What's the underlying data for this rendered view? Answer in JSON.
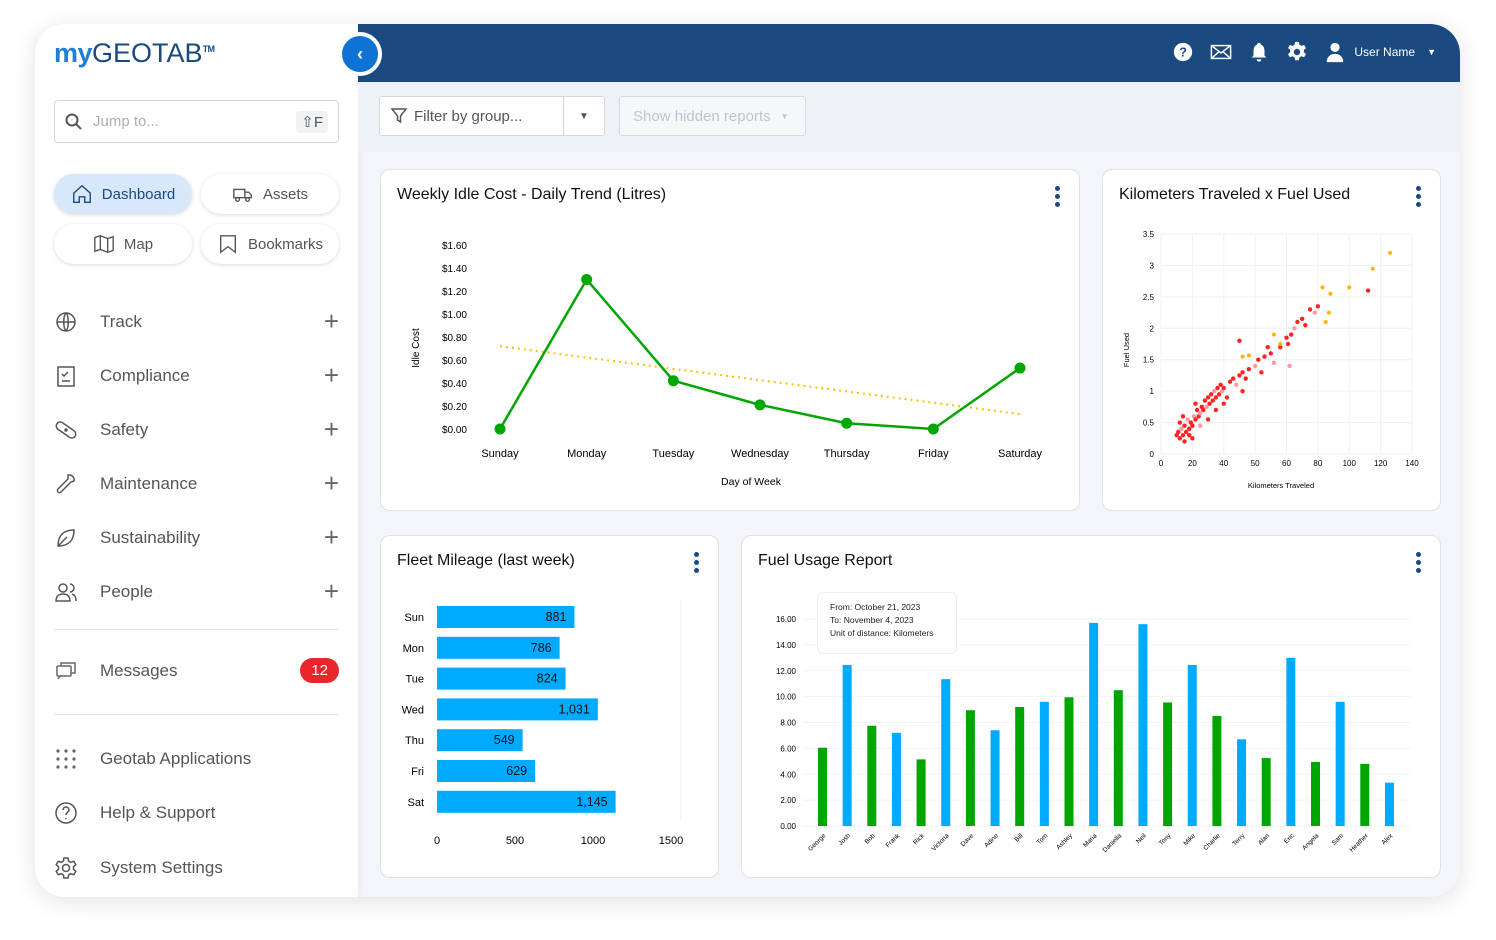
{
  "app": {
    "logo_my": "my",
    "logo_geotab": "GEOTAB",
    "logo_tm": "TM"
  },
  "search": {
    "placeholder": "Jump to...",
    "shortcut": "⇧F"
  },
  "quick": [
    {
      "label": "Dashboard",
      "icon": "home-icon",
      "active": true
    },
    {
      "label": "Assets",
      "icon": "truck-icon"
    },
    {
      "label": "Map",
      "icon": "map-icon"
    },
    {
      "label": "Bookmarks",
      "icon": "bookmark-icon"
    }
  ],
  "nav": [
    {
      "label": "Track",
      "icon": "globe-icon"
    },
    {
      "label": "Compliance",
      "icon": "clipboard-icon"
    },
    {
      "label": "Safety",
      "icon": "bandage-icon"
    },
    {
      "label": "Maintenance",
      "icon": "wrench-icon"
    },
    {
      "label": "Sustainability",
      "icon": "leaf-icon"
    },
    {
      "label": "People",
      "icon": "people-icon"
    }
  ],
  "messages": {
    "label": "Messages",
    "count": "12"
  },
  "bottom_nav": [
    {
      "label": "Geotab Applications",
      "icon": "grid-icon"
    },
    {
      "label": "Help & Support",
      "icon": "help-icon"
    },
    {
      "label": "System Settings",
      "icon": "gear-icon"
    }
  ],
  "header": {
    "user": "User Name"
  },
  "filters": {
    "group_placeholder": "Filter by group...",
    "hidden_reports": "Show hidden reports"
  },
  "colors": {
    "header": "#1a4a80",
    "accent": "#0f73d6",
    "green": "#00a600",
    "blue": "#00aaff",
    "trend": "#f5c400"
  },
  "chart_data": [
    {
      "type": "line",
      "title": "Weekly Idle Cost - Daily Trend (Litres)",
      "xlabel": "Day of Week",
      "ylabel": "Idle Cost",
      "categories": [
        "Sunday",
        "Monday",
        "Tuesday",
        "Wednesday",
        "Thursday",
        "Friday",
        "Saturday"
      ],
      "values": [
        0.0,
        1.3,
        0.42,
        0.21,
        0.05,
        0.0,
        0.53
      ],
      "trend": [
        0.72,
        0.13
      ],
      "yticks": [
        "$0.00",
        "$0.20",
        "$0.40",
        "$0.60",
        "$0.80",
        "$1.00",
        "$1.20",
        "$1.40",
        "$1.60"
      ],
      "ylim": [
        0,
        1.6
      ]
    },
    {
      "type": "scatter",
      "title": "Kilometers Traveled x Fuel Used",
      "xlabel": "Kilometers Traveled",
      "ylabel": "Fuel Used",
      "xticks": [
        "0",
        "20",
        "40",
        "50",
        "60",
        "80",
        "100",
        "120",
        "140"
      ],
      "yticks": [
        "0",
        "0.5",
        "1",
        "1.5",
        "2",
        "2.5",
        "3",
        "3.5"
      ],
      "xlim": [
        0,
        140
      ],
      "ylim": [
        0,
        3.5
      ],
      "points": [
        [
          10,
          0.3
        ],
        [
          11,
          0.35
        ],
        [
          12,
          0.25
        ],
        [
          13,
          0.4
        ],
        [
          14,
          0.3
        ],
        [
          15,
          0.45
        ],
        [
          12,
          0.5
        ],
        [
          16,
          0.35
        ],
        [
          17,
          0.55
        ],
        [
          18,
          0.4
        ],
        [
          14,
          0.6
        ],
        [
          19,
          0.5
        ],
        [
          20,
          0.45
        ],
        [
          21,
          0.6
        ],
        [
          22,
          0.55
        ],
        [
          18,
          0.3
        ],
        [
          23,
          0.7
        ],
        [
          24,
          0.6
        ],
        [
          25,
          0.65
        ],
        [
          26,
          0.75
        ],
        [
          22,
          0.8
        ],
        [
          27,
          0.7
        ],
        [
          28,
          0.85
        ],
        [
          29,
          0.75
        ],
        [
          30,
          0.9
        ],
        [
          31,
          0.8
        ],
        [
          32,
          0.95
        ],
        [
          33,
          0.85
        ],
        [
          34,
          1.0
        ],
        [
          35,
          0.9
        ],
        [
          36,
          1.05
        ],
        [
          37,
          0.95
        ],
        [
          38,
          1.1
        ],
        [
          39,
          1.0
        ],
        [
          40,
          1.05
        ],
        [
          41,
          0.9
        ],
        [
          42,
          1.15
        ],
        [
          43,
          1.2
        ],
        [
          44,
          1.1
        ],
        [
          45,
          1.25
        ],
        [
          46,
          1.3
        ],
        [
          47,
          1.2
        ],
        [
          48,
          1.35
        ],
        [
          50,
          1.4
        ],
        [
          51,
          1.5
        ],
        [
          52,
          1.3
        ],
        [
          53,
          1.55
        ],
        [
          55,
          1.6
        ],
        [
          56,
          1.45
        ],
        [
          58,
          1.7
        ],
        [
          60,
          1.85
        ],
        [
          61,
          1.75
        ],
        [
          63,
          1.9
        ],
        [
          65,
          2.0
        ],
        [
          67,
          2.1
        ],
        [
          70,
          2.15
        ],
        [
          72,
          2.05
        ],
        [
          75,
          2.3
        ],
        [
          78,
          2.25
        ],
        [
          80,
          2.35
        ],
        [
          112,
          2.6
        ],
        [
          30,
          0.55
        ],
        [
          35,
          0.7
        ],
        [
          25,
          0.45
        ],
        [
          40,
          0.8
        ],
        [
          46,
          1.0
        ],
        [
          54,
          1.7
        ],
        [
          45,
          1.8
        ],
        [
          62,
          1.4
        ],
        [
          20,
          0.25
        ],
        [
          15,
          0.2
        ]
      ],
      "highlight": [
        [
          46,
          1.55
        ],
        [
          48,
          1.57
        ],
        [
          56,
          1.9
        ],
        [
          58,
          1.75
        ],
        [
          83,
          2.65
        ],
        [
          85,
          2.1
        ],
        [
          87,
          2.25
        ],
        [
          88,
          2.55
        ],
        [
          100,
          2.65
        ],
        [
          115,
          2.95
        ],
        [
          126,
          3.2
        ]
      ]
    },
    {
      "type": "bar",
      "orientation": "horizontal",
      "title": "Fleet Mileage (last week)",
      "categories": [
        "Sun",
        "Mon",
        "Tue",
        "Wed",
        "Thu",
        "Fri",
        "Sat"
      ],
      "values": [
        881,
        786,
        824,
        1031,
        549,
        629,
        1145
      ],
      "labels": [
        "881",
        "786",
        "824",
        "1,031",
        "549",
        "629",
        "1,145"
      ],
      "xticks": [
        "0",
        "500",
        "1000",
        "1500"
      ],
      "xlim": [
        0,
        1500
      ]
    },
    {
      "type": "bar",
      "title": "Fuel Usage Report",
      "annotation": [
        "From: October 21, 2023",
        "To: November 4, 2023",
        "Unit of distance: Kilometers"
      ],
      "categories": [
        "George",
        "Josh",
        "Bob",
        "Frank",
        "Rick",
        "Victoria",
        "Dave",
        "Adine",
        "Bill",
        "Tom",
        "Ashley",
        "Maria",
        "Daniella",
        "Neil",
        "Tony",
        "Mike",
        "Charlie",
        "Terry",
        "Alan",
        "Eric",
        "Angela",
        "Sam",
        "Heather",
        "Alex"
      ],
      "values": [
        6.05,
        12.45,
        7.75,
        7.2,
        5.15,
        11.35,
        8.95,
        7.4,
        9.2,
        9.6,
        9.95,
        15.7,
        10.5,
        15.6,
        9.55,
        12.45,
        8.5,
        6.7,
        5.25,
        13.0,
        4.95,
        9.6,
        4.8,
        3.35
      ],
      "yticks": [
        "0.00",
        "2.00",
        "4.00",
        "6.00",
        "8.00",
        "10.00",
        "12.00",
        "14.00",
        "16.00"
      ],
      "ylim": [
        0,
        16
      ]
    }
  ]
}
